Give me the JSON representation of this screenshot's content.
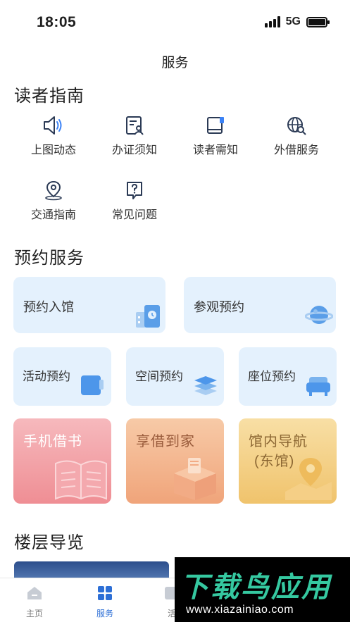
{
  "status": {
    "time": "18:05",
    "network": "5G"
  },
  "nav": {
    "title": "服务"
  },
  "reader_guide": {
    "title": "读者指南",
    "items": [
      {
        "label": "上图动态",
        "icon": "speaker-icon"
      },
      {
        "label": "办证须知",
        "icon": "card-id-icon"
      },
      {
        "label": "读者需知",
        "icon": "book-notice-icon"
      },
      {
        "label": "外借服务",
        "icon": "globe-search-icon"
      },
      {
        "label": "交通指南",
        "icon": "location-pin-icon"
      },
      {
        "label": "常见问题",
        "icon": "question-icon"
      }
    ]
  },
  "reservation": {
    "title": "预约服务",
    "cards": [
      {
        "label": "预约入馆"
      },
      {
        "label": "参观预约"
      },
      {
        "label": "活动预约"
      },
      {
        "label": "空间预约"
      },
      {
        "label": "座位预约"
      },
      {
        "label": "手机借书"
      },
      {
        "label": "享借到家"
      },
      {
        "label": "馆内导航",
        "sub": "(东馆)"
      }
    ]
  },
  "floor_guide": {
    "title": "楼层导览"
  },
  "tab_bar": {
    "tabs": [
      {
        "label": "主页",
        "icon": "home-icon"
      },
      {
        "label": "服务",
        "icon": "grid-icon"
      },
      {
        "label": "活",
        "icon": "activity-icon"
      }
    ]
  },
  "watermark": {
    "title": "下载鸟应用",
    "url": "www.xiazainiao.com"
  },
  "colors": {
    "accent": "#2d6fd6",
    "icon_stroke": "#2b3a55",
    "card_blue": "#e4f1fd"
  }
}
